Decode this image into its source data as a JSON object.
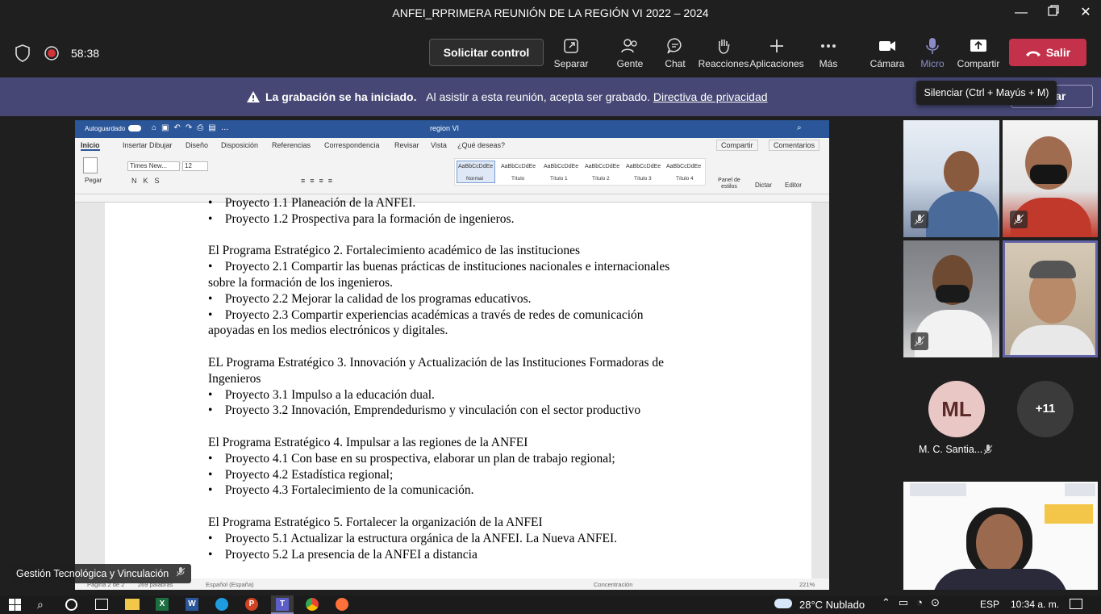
{
  "window": {
    "title": "ANFEI_RPRIMERA REUNIÓN DE LA REGIÓN VI 2022 – 2024"
  },
  "toolbar": {
    "timer": "58:38",
    "request_control": "Solicitar control",
    "buttons": [
      {
        "label": "Separar",
        "icon": "popout-icon"
      },
      {
        "label": "Gente",
        "icon": "people-icon"
      },
      {
        "label": "Chat",
        "icon": "chat-icon"
      },
      {
        "label": "Reacciones",
        "icon": "reactions-icon"
      },
      {
        "label": "Aplicaciones",
        "icon": "apps-icon"
      },
      {
        "label": "Más",
        "icon": "more-icon"
      },
      {
        "label": "Cámara",
        "icon": "camera-icon"
      },
      {
        "label": "Micro",
        "icon": "microphone-icon"
      },
      {
        "label": "Compartir",
        "icon": "share-icon"
      }
    ],
    "leave": "Salir"
  },
  "banner": {
    "strong": "La grabación se ha iniciado.",
    "text": "Al asistir a esta reunión, acepta ser grabado.",
    "link": "Directiva de privacidad",
    "dismiss_partial": "rtar"
  },
  "tooltip": "Silenciar (Ctrl + Mayús + M)",
  "word": {
    "autosave": "Autoguardado",
    "doc_title": "region VI",
    "tabs": [
      "Inicio",
      "Insertar",
      "Dibujar",
      "Diseño",
      "Disposición",
      "Referencias",
      "Correspondencia",
      "Revisar",
      "Vista",
      "¿Qué deseas?"
    ],
    "share": "Compartir",
    "comments": "Comentarios",
    "font": "Times New...",
    "size": "12",
    "paste": "Pegar",
    "styles": [
      "Normal",
      "Título",
      "Título 1",
      "Título 2",
      "Título 3",
      "Título 4"
    ],
    "style_preview": "AaBbCcDdEe",
    "panel": "Panel de estilos",
    "dictate": "Dictar",
    "editor": "Editor",
    "status": {
      "page": "Página 2 de 2",
      "words": "269 palabras",
      "lang": "Español (España)",
      "focus": "Concentración",
      "zoom": "221%"
    },
    "lines": [
      "•    Proyecto 1.1 Planeación de la ANFEI.",
      "•    Proyecto 1.2 Prospectiva para la formación de ingenieros.",
      "",
      "El Programa Estratégico 2. Fortalecimiento académico de las instituciones",
      "•    Proyecto 2.1 Compartir las buenas prácticas de instituciones nacionales e internacionales",
      "sobre la formación de los ingenieros.",
      "•    Proyecto 2.2 Mejorar la calidad de los programas educativos.",
      "•    Proyecto 2.3 Compartir experiencias académicas a través de redes de comunicación",
      "apoyadas en los medios electrónicos y digitales.",
      "",
      "EL Programa Estratégico 3. Innovación y Actualización de las Instituciones Formadoras de",
      "Ingenieros",
      "•    Proyecto 3.1 Impulso a la educación dual.",
      "•    Proyecto 3.2 Innovación, Emprendedurismo y vinculación con el sector productivo",
      "",
      "El Programa Estratégico 4. Impulsar a las regiones de la ANFEI",
      "•    Proyecto 4.1 Con base en su prospectiva, elaborar un plan de trabajo regional;",
      "•    Proyecto 4.2 Estadística regional;",
      "•    Proyecto 4.3 Fortalecimiento de la comunicación.",
      "",
      "El Programa Estratégico 5. Fortalecer la organización de la ANFEI",
      "•    Proyecto 5.1 Actualizar la estructura orgánica de la ANFEI. La Nueva ANFEI.",
      "•    Proyecto 5.2 La presencia de la ANFEI a distancia"
    ]
  },
  "presenter_label": "Gestión Tecnológica y Vinculación",
  "participants": {
    "initials": "ML",
    "name": "M. C. Santia...",
    "more": "+11"
  },
  "taskbar": {
    "weather": "28°C  Nublado",
    "lang": "ESP",
    "time": "10:34 a. m."
  }
}
